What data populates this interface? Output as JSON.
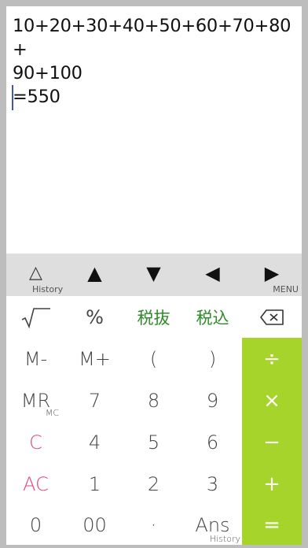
{
  "display": {
    "expression": "10+20+30+40+50+60+70+80+\n90+100\n=550"
  },
  "nav": {
    "history_label": "History",
    "menu_label": "MENU",
    "triangle_outline": "△",
    "up": "▲",
    "down": "▼",
    "left": "◀",
    "right": "▶"
  },
  "keys": {
    "sqrt": "√",
    "percent": "%",
    "tax_exclude": "税抜",
    "tax_include": "税込",
    "m_minus": "M-",
    "m_plus": "M+",
    "paren_open": "(",
    "paren_close": ")",
    "divide": "÷",
    "mr": "MR",
    "mc": "MC",
    "seven": "7",
    "eight": "8",
    "nine": "9",
    "multiply": "×",
    "clear": "C",
    "four": "4",
    "five": "5",
    "six": "6",
    "minus": "−",
    "all_clear": "AC",
    "one": "1",
    "two": "2",
    "three": "3",
    "plus": "+",
    "zero": "0",
    "double_zero": "00",
    "decimal": "·",
    "ans": "Ans",
    "ans_history": "History",
    "equals": "="
  },
  "colors": {
    "operator_green": "#a6d42b",
    "tax_green": "#2f8a28",
    "clear_pink": "#e0457a",
    "caret_blue": "#3f58b8"
  }
}
